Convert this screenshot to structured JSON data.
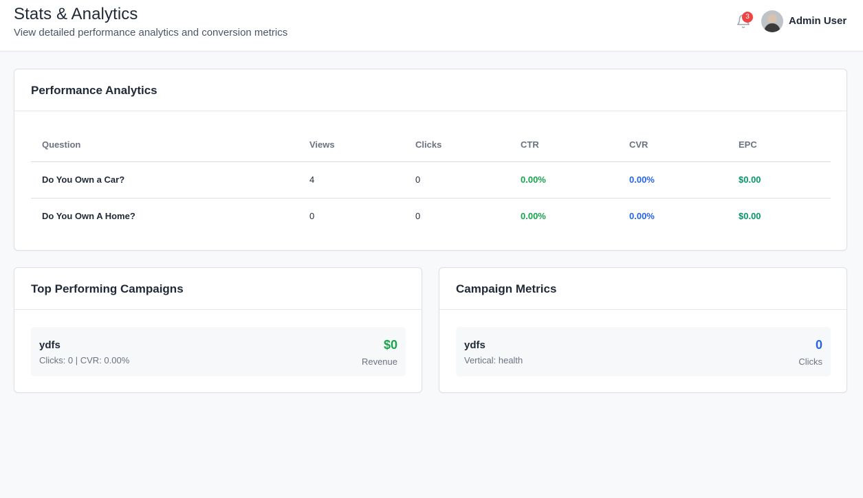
{
  "header": {
    "title": "Stats & Analytics",
    "subtitle": "View detailed performance analytics and conversion metrics",
    "notification_count": "3",
    "user_name": "Admin User"
  },
  "performance": {
    "title": "Performance Analytics",
    "columns": [
      "Question",
      "Views",
      "Clicks",
      "CTR",
      "CVR",
      "EPC"
    ],
    "rows": [
      {
        "question": "Do You Own a Car?",
        "views": "4",
        "clicks": "0",
        "ctr": "0.00%",
        "cvr": "0.00%",
        "epc": "$0.00"
      },
      {
        "question": "Do You Own A Home?",
        "views": "0",
        "clicks": "0",
        "ctr": "0.00%",
        "cvr": "0.00%",
        "epc": "$0.00"
      }
    ]
  },
  "top_campaigns": {
    "title": "Top Performing Campaigns",
    "items": [
      {
        "name": "ydfs",
        "meta": "Clicks: 0 | CVR: 0.00%",
        "value": "$0",
        "label": "Revenue"
      }
    ]
  },
  "campaign_metrics": {
    "title": "Campaign Metrics",
    "items": [
      {
        "name": "ydfs",
        "meta": "Vertical: health",
        "value": "0",
        "label": "Clicks"
      }
    ]
  },
  "colors": {
    "green": "#16a34a",
    "blue": "#2563eb",
    "badge": "#ef4444"
  },
  "icons": {
    "notification": "bell-icon",
    "user": "avatar"
  }
}
